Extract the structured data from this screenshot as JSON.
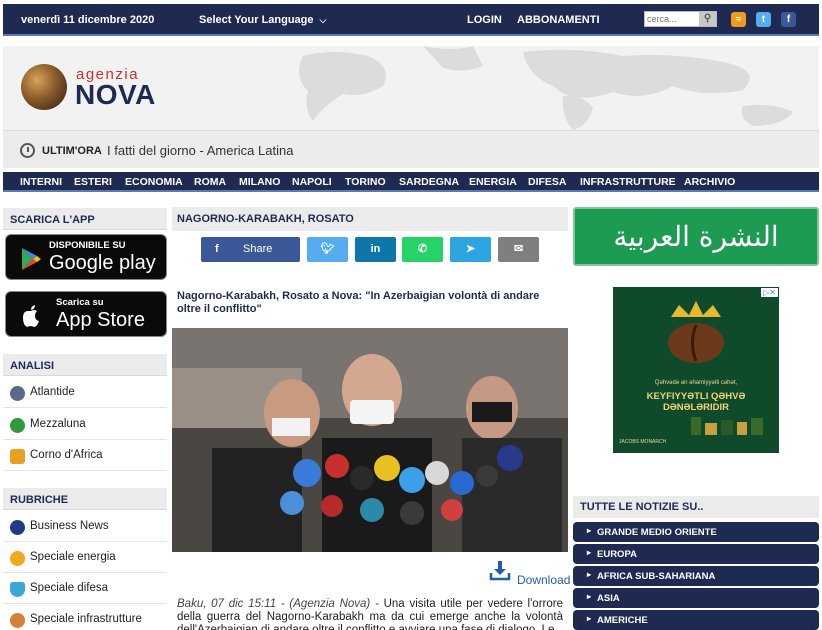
{
  "topbar": {
    "date": "venerdì 11 dicembre 2020",
    "language_label": "Select Your Language",
    "login": "LOGIN",
    "subscriptions": "ABBONAMENTI",
    "search_placeholder": "cerca..."
  },
  "logo": {
    "agenzia": "agenzia",
    "nova": "NOVA"
  },
  "breaking": {
    "label": "ULTIM'ORA",
    "text": "I fatti del giorno - America Latina"
  },
  "main_nav": [
    "INTERNI",
    "ESTERI",
    "ECONOMIA",
    "ROMA",
    "MILANO",
    "NAPOLI",
    "TORINO",
    "SARDEGNA",
    "ENERGIA",
    "DIFESA",
    "INFRASTRUTTURE",
    "ARCHIVIO"
  ],
  "left": {
    "app_heading": "SCARICA L'APP",
    "google_play": {
      "small": "DISPONIBILE SU",
      "big": "Google play"
    },
    "app_store": {
      "small": "Scarica su",
      "big": "App Store"
    },
    "analisi_heading": "ANALISI",
    "analisi": [
      "Atlantide",
      "Mezzaluna",
      "Corno d'Africa"
    ],
    "rubriche_heading": "RUBRICHE",
    "rubriche": [
      "Business News",
      "Speciale energia",
      "Speciale difesa",
      "Speciale infrastrutture"
    ]
  },
  "article": {
    "section": "NAGORNO-KARABAKH, ROSATO",
    "share_label": "Share",
    "headline": "Nagorno-Karabakh, Rosato a Nova: \"In Azerbaigian volontà di andare oltre il conflitto\"",
    "download": "Download",
    "dateline": "Baku, 07 dic 15:11 - (Agenzia Nova) -",
    "body": " Una visita utile per vedere l'orrore della guerra del Nagorno-Karabakh ma da cui emerge anche la volontà dell'Azerbaigian di andare oltre il conflitto e avviare una fase di dialogo. Le"
  },
  "right": {
    "arabic_banner": "النشرة العربية",
    "ad": {
      "line1": "Qəhvədə ən əhəmiyyətli cəhət,",
      "line2": "KEYFIYYƏTLI QƏHVƏ DƏNƏLƏRIDIR",
      "brand": "JACOBS MONARCH"
    },
    "news_heading": "TUTTE LE NOTIZIE SU..",
    "news_items": [
      "GRANDE MEDIO ORIENTE",
      "EUROPA",
      "AFRICA SUB-SAHARIANA",
      "ASIA",
      "AMERICHE"
    ]
  },
  "colors": {
    "navy": "#1f2a52",
    "accent_blue": "#5b7bb0",
    "facebook": "#3b5998",
    "twitter": "#55acee",
    "linkedin": "#0e76a8",
    "whatsapp": "#25d366",
    "telegram": "#2ca5e0",
    "email": "#7f7f7f",
    "arabic_green": "#1e9b52"
  },
  "icons": {
    "share_buttons": [
      "facebook-icon",
      "twitter-icon",
      "linkedin-icon",
      "whatsapp-icon",
      "telegram-icon",
      "email-icon"
    ],
    "social_top": [
      "rss-icon",
      "twitter-icon",
      "facebook-icon"
    ]
  }
}
